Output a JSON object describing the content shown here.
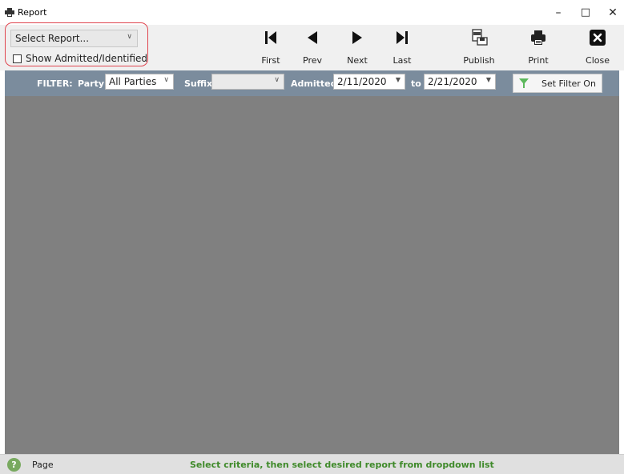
{
  "window": {
    "title": "Report",
    "minimize": "–",
    "maximize": "□",
    "close": "✕"
  },
  "toolbar": {
    "report_select": "Select Report...",
    "show_admitted": "Show Admitted/Identified",
    "show_admitted_checked": false,
    "first": "First",
    "prev": "Prev",
    "next": "Next",
    "last": "Last",
    "publish": "Publish",
    "print": "Print",
    "close": "Close"
  },
  "filter": {
    "label": "FILTER:",
    "party_label": "Party:",
    "party_value": "All Parties",
    "suffix_label": "Suffix:",
    "suffix_value": "",
    "admitted_label": "Admitted:",
    "admitted_from": "2/11/2020",
    "to_label": "to",
    "admitted_to": "2/21/2020",
    "set_filter": "Set Filter On"
  },
  "status": {
    "help": "?",
    "page_label": "Page",
    "message": "Select criteria, then select desired report from dropdown list"
  },
  "colors": {
    "filter_bar": "#7b8c9d",
    "content_bg": "#808080",
    "status_msg": "#3f8a2a",
    "highlight_border": "#e0454f",
    "help_icon": "#78a95f"
  }
}
